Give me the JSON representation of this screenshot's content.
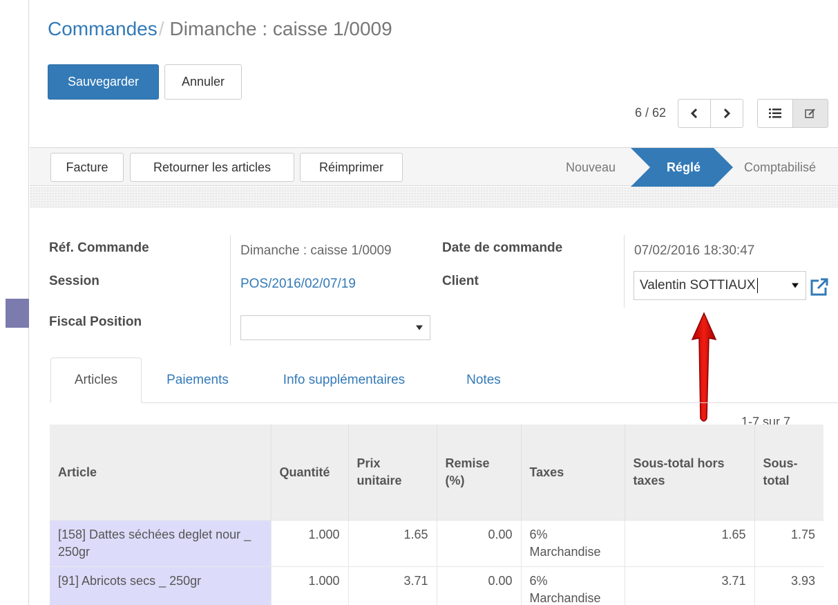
{
  "breadcrumb": {
    "parent": "Commandes",
    "separator": "/",
    "current": "Dimanche : caisse 1/0009"
  },
  "buttons": {
    "save": "Sauvegarder",
    "discard": "Annuler"
  },
  "pager": {
    "value": "6 / 62",
    "prev_icon": "chevron-left-icon",
    "next_icon": "chevron-right-icon"
  },
  "views": {
    "list_icon": "list-icon",
    "form_icon": "edit-icon"
  },
  "header_buttons": {
    "invoice": "Facture",
    "return": "Retourner les articles",
    "reprint": "Réimprimer"
  },
  "stages": [
    {
      "label": "Nouveau",
      "active": false
    },
    {
      "label": "Réglé",
      "active": true
    },
    {
      "label": "Comptabilisé",
      "active": false
    }
  ],
  "form": {
    "order_ref": {
      "label": "Réf. Commande",
      "value": "Dimanche : caisse 1/0009"
    },
    "session": {
      "label": "Session",
      "value": "POS/2016/02/07/19"
    },
    "fiscal_position": {
      "label": "Fiscal Position",
      "value": ""
    },
    "order_date": {
      "label": "Date de commande",
      "value": "07/02/2016 18:30:47"
    },
    "client": {
      "label": "Client",
      "value": "Valentin SOTTIAUX"
    }
  },
  "tabs": [
    {
      "label": "Articles",
      "active": true
    },
    {
      "label": "Paiements",
      "active": false
    },
    {
      "label": "Info supplémentaires",
      "active": false
    },
    {
      "label": "Notes",
      "active": false
    }
  ],
  "lines_pager": "1-7 sur 7",
  "table": {
    "headers": [
      "Article",
      "Quantité",
      "Prix unitaire",
      "Remise (%)",
      "Taxes",
      "Sous-total hors taxes",
      "Sous-total"
    ],
    "rows": [
      {
        "article": "[158] Dattes séchées deglet nour _ 250gr",
        "qty": "1.000",
        "price": "1.65",
        "discount": "0.00",
        "taxes": "6% Marchandise",
        "subtotal_excl": "1.65",
        "subtotal": "1.75"
      },
      {
        "article": "[91] Abricots secs _ 250gr",
        "qty": "1.000",
        "price": "3.71",
        "discount": "0.00",
        "taxes": "6% Marchandise",
        "subtotal_excl": "3.71",
        "subtotal": "3.93"
      }
    ]
  },
  "colors": {
    "primary": "#337ab7",
    "stage_active": "#337ab7",
    "arrow": "#e3120b",
    "article_cell": "#dcdcfa"
  }
}
